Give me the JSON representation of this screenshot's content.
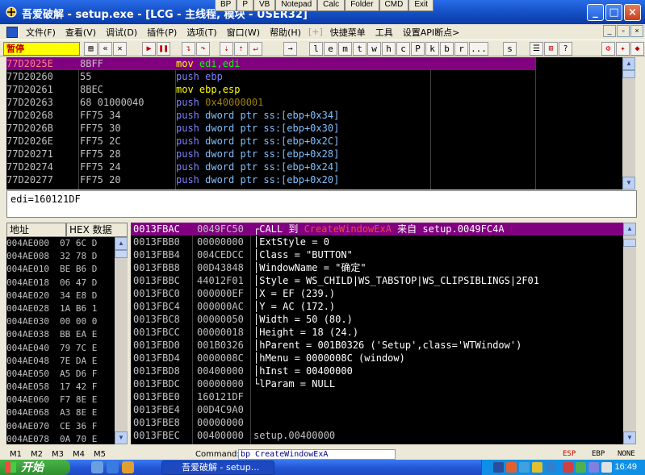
{
  "window": {
    "title": "吾爱破解 - setup.exe - [LCG - 主线程, 模块 - USER32]"
  },
  "plugin_buttons": [
    "BP",
    "P",
    "VB",
    "Notepad",
    "Calc",
    "Folder",
    "CMD",
    "Exit"
  ],
  "menu": [
    "文件(F)",
    "查看(V)",
    "调试(D)",
    "插件(P)",
    "选项(T)",
    "窗口(W)",
    "帮助(H)",
    "[+]",
    "快捷菜单",
    "工具",
    "设置API断点>"
  ],
  "toolbar": {
    "status": "暂停",
    "letters": [
      "l",
      "e",
      "m",
      "t",
      "w",
      "h",
      "c",
      "P",
      "k",
      "b",
      "r",
      "...",
      "s"
    ]
  },
  "disasm": [
    {
      "addr": "77D2025E",
      "hex": "8BFF",
      "op": "mov",
      "args": "edi,edi",
      "kind": "mov_reg"
    },
    {
      "addr": "77D20260",
      "hex": "55",
      "op": "push",
      "args": "ebp",
      "kind": "push_reg"
    },
    {
      "addr": "77D20261",
      "hex": "8BEC",
      "op": "mov",
      "args": "ebp,esp",
      "kind": "mov_reg"
    },
    {
      "addr": "77D20263",
      "hex": "68 01000040",
      "op": "push",
      "args": "0x40000001",
      "kind": "push_imm"
    },
    {
      "addr": "77D20268",
      "hex": "FF75 34",
      "op": "push",
      "args": "dword ptr ss:[ebp+0x34]",
      "kind": "push_mem"
    },
    {
      "addr": "77D2026B",
      "hex": "FF75 30",
      "op": "push",
      "args": "dword ptr ss:[ebp+0x30]",
      "kind": "push_mem"
    },
    {
      "addr": "77D2026E",
      "hex": "FF75 2C",
      "op": "push",
      "args": "dword ptr ss:[ebp+0x2C]",
      "kind": "push_mem"
    },
    {
      "addr": "77D20271",
      "hex": "FF75 28",
      "op": "push",
      "args": "dword ptr ss:[ebp+0x28]",
      "kind": "push_mem"
    },
    {
      "addr": "77D20274",
      "hex": "FF75 24",
      "op": "push",
      "args": "dword ptr ss:[ebp+0x24]",
      "kind": "push_mem"
    },
    {
      "addr": "77D20277",
      "hex": "FF75 20",
      "op": "push",
      "args": "dword ptr ss:[ebp+0x20]",
      "kind": "push_mem"
    }
  ],
  "info_line": "edi=160121DF",
  "dump": {
    "headers": [
      "地址",
      "HEX 数据"
    ],
    "rows": [
      {
        "addr": "004AE000",
        "hex": "07 6C D"
      },
      {
        "addr": "004AE008",
        "hex": "32 78 D"
      },
      {
        "addr": "004AE010",
        "hex": "BE B6 D"
      },
      {
        "addr": "004AE018",
        "hex": "06 47 D"
      },
      {
        "addr": "004AE020",
        "hex": "34 E8 D"
      },
      {
        "addr": "004AE028",
        "hex": "1A B6 1"
      },
      {
        "addr": "004AE030",
        "hex": "00 00 0"
      },
      {
        "addr": "004AE038",
        "hex": "BB EA E"
      },
      {
        "addr": "004AE040",
        "hex": "79 7C E"
      },
      {
        "addr": "004AE048",
        "hex": "7E DA E"
      },
      {
        "addr": "004AE050",
        "hex": "A5 D6 F"
      },
      {
        "addr": "004AE058",
        "hex": "17 42 F"
      },
      {
        "addr": "004AE060",
        "hex": "F7 8E E"
      },
      {
        "addr": "004AE068",
        "hex": "A3 8E E"
      },
      {
        "addr": "004AE070",
        "hex": "CE 36 F"
      },
      {
        "addr": "004AE078",
        "hex": "0A 70 E"
      }
    ]
  },
  "stack": {
    "call_line": {
      "prefix": "CALL 到 ",
      "func": "CreateWindowExA",
      "mid": " 来自 ",
      "from": "setup.0049FC4A"
    },
    "rows": [
      {
        "addr": "0013FBAC",
        "val": "0049FC50",
        "cmt": ""
      },
      {
        "addr": "0013FBB0",
        "val": "00000000",
        "cmt": "ExtStyle = 0"
      },
      {
        "addr": "0013FBB4",
        "val": "004CEDCC",
        "cmt": "Class = \"BUTTON\""
      },
      {
        "addr": "0013FBB8",
        "val": "00D43848",
        "cmt": "WindowName = \"确定\""
      },
      {
        "addr": "0013FBBC",
        "val": "44012F01",
        "cmt": "Style = WS_CHILD|WS_TABSTOP|WS_CLIPSIBLINGS|2F01"
      },
      {
        "addr": "0013FBC0",
        "val": "000000EF",
        "cmt": "X = EF (239.)"
      },
      {
        "addr": "0013FBC4",
        "val": "000000AC",
        "cmt": "Y = AC (172.)"
      },
      {
        "addr": "0013FBC8",
        "val": "00000050",
        "cmt": "Width = 50 (80.)"
      },
      {
        "addr": "0013FBCC",
        "val": "00000018",
        "cmt": "Height = 18 (24.)"
      },
      {
        "addr": "0013FBD0",
        "val": "001B0326",
        "cmt": "hParent = 001B0326 ('Setup',class='WTWindow')"
      },
      {
        "addr": "0013FBD4",
        "val": "0000008C",
        "cmt": "hMenu = 0000008C (window)"
      },
      {
        "addr": "0013FBD8",
        "val": "00400000",
        "cmt": "hInst = 00400000"
      },
      {
        "addr": "0013FBDC",
        "val": "00000000",
        "cmt": "lParam = NULL"
      },
      {
        "addr": "0013FBE0",
        "val": "160121DF",
        "cmt": ""
      },
      {
        "addr": "0013FBE4",
        "val": "00D4C9A0",
        "cmt": ""
      },
      {
        "addr": "0013FBE8",
        "val": "00000000",
        "cmt": ""
      },
      {
        "addr": "0013FBEC",
        "val": "00400000",
        "cmt": "setup.00400000"
      }
    ]
  },
  "cmdbar": {
    "tabs": [
      "M1",
      "M2",
      "M3",
      "M4",
      "M5"
    ],
    "label": "Command:",
    "input_value": "bp CreateWindowExA",
    "regs": [
      "ESP",
      "EBP",
      "NONE"
    ]
  },
  "taskbar": {
    "start": "开始",
    "task": "吾爱破解 - setup...",
    "clock": "16:49"
  }
}
